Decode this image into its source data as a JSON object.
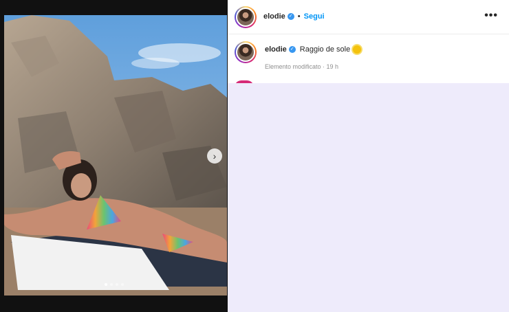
{
  "post": {
    "username": "elodie",
    "follow_label": "Segui",
    "bullet": "•",
    "more_label": "•••",
    "verified_mark": "✓"
  },
  "caption": {
    "username": "elodie",
    "text": "Raggio de sole",
    "emoji": "sun-emoji",
    "meta": "Elemento modificato · 19 h"
  },
  "carousel": {
    "next_label": "›",
    "slide_count": 4,
    "active_index": 0
  },
  "colors": {
    "follow_blue": "#0095f6",
    "verified_blue": "#3897f0",
    "panel_bg": "#eeebfb"
  }
}
